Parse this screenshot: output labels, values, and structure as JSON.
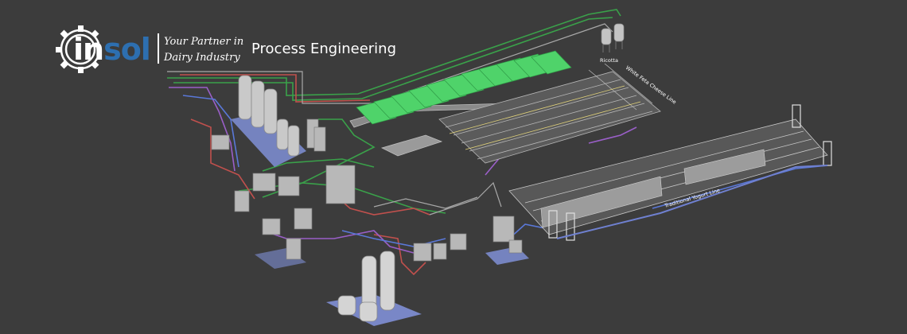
{
  "logo": {
    "brand_prefix": "in",
    "brand_suffix": "sol",
    "icon": "gear-icon",
    "tagline_line1": "Your Partner in",
    "tagline_line2": "Dairy Industry",
    "accent_color": "#2d6fb0"
  },
  "heading": "Process Engineering",
  "plant_labels": {
    "storage": "Ricotta",
    "white_cheese_line": "White Feta Cheese Line",
    "yogurt_line": "Traditional Yogurt Line"
  },
  "colors": {
    "background": "#3c3c3c",
    "green_beds": "#4fd36a",
    "pipe_green": "#3aa14a",
    "pipe_red": "#c0504d",
    "pipe_purple": "#9a5fc8",
    "pipe_blue": "#5a78d8",
    "floor_blue": "#7f8fd6"
  }
}
